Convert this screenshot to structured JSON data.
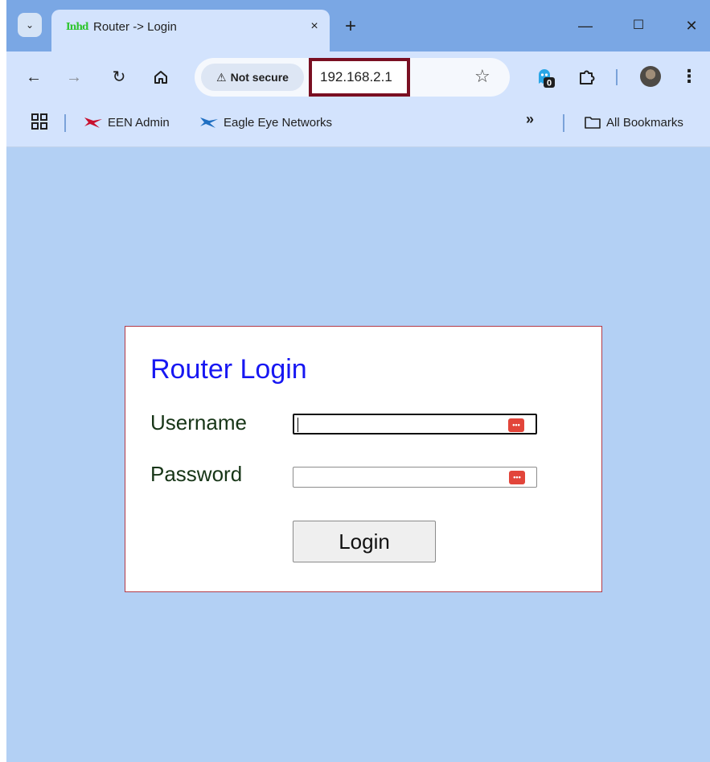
{
  "browser": {
    "tab": {
      "favicon_text": "Inhd",
      "title": "Router -> Login",
      "close_glyph": "×"
    },
    "new_tab_glyph": "+",
    "window_controls": {
      "minimize": "—",
      "maximize": "☐",
      "close": "✕"
    },
    "toolbar": {
      "security_label": "Not secure",
      "url": "192.168.2.1",
      "extension_badge": "0"
    },
    "bookmarks": {
      "items": [
        {
          "label": "EEN Admin",
          "icon": "een-logo-icon",
          "color": "#c8102e"
        },
        {
          "label": "Eagle Eye Networks",
          "icon": "een-logo-icon",
          "color": "#1f6fc2"
        }
      ],
      "overflow_glyph": "»",
      "all_bookmarks_label": "All Bookmarks"
    }
  },
  "page": {
    "title": "Router Login",
    "username_label": "Username",
    "password_label": "Password",
    "login_button": "Login",
    "colors": {
      "background": "#b3d0f4",
      "title": "#1717f2",
      "labels": "#173517",
      "box_border": "#b23a48"
    }
  }
}
